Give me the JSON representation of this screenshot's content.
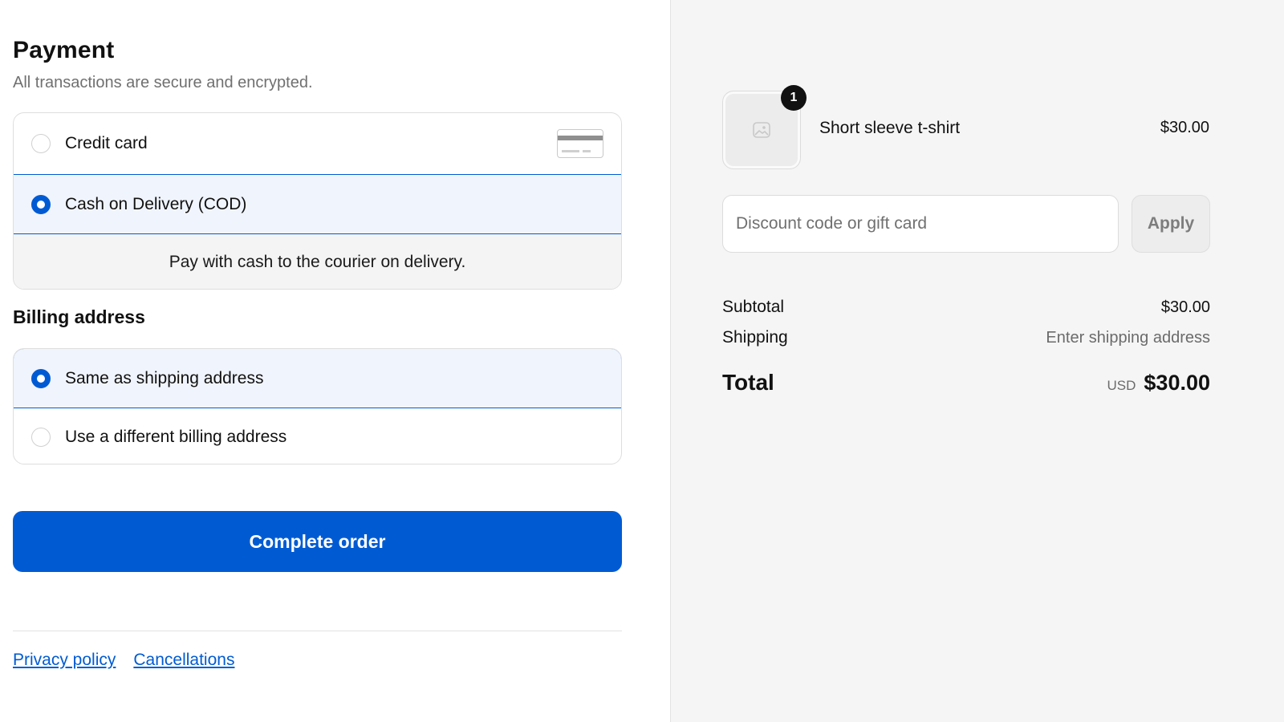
{
  "payment": {
    "title": "Payment",
    "subtitle": "All transactions are secure and encrypted.",
    "options": [
      {
        "label": "Credit card",
        "selected": false,
        "icon": "credit-card-icon"
      },
      {
        "label": "Cash on Delivery (COD)",
        "selected": true
      }
    ],
    "cod_note": "Pay with cash to the courier on delivery."
  },
  "billing": {
    "title": "Billing address",
    "options": [
      {
        "label": "Same as shipping address",
        "selected": true
      },
      {
        "label": "Use a different billing address",
        "selected": false
      }
    ]
  },
  "actions": {
    "complete_label": "Complete order"
  },
  "footer": {
    "links": [
      "Privacy policy",
      "Cancellations"
    ]
  },
  "summary": {
    "item": {
      "name": "Short sleeve t-shirt",
      "price": "$30.00",
      "quantity": "1",
      "icon": "image-placeholder-icon"
    },
    "discount": {
      "placeholder": "Discount code or gift card",
      "value": "",
      "apply_label": "Apply"
    },
    "subtotal_label": "Subtotal",
    "subtotal_value": "$30.00",
    "shipping_label": "Shipping",
    "shipping_value": "Enter shipping address",
    "total_label": "Total",
    "total_currency": "USD",
    "total_value": "$30.00"
  },
  "colors": {
    "accent": "#005bd3",
    "selected_bg": "#f0f4fc",
    "sidebar_bg": "#f5f5f5"
  }
}
